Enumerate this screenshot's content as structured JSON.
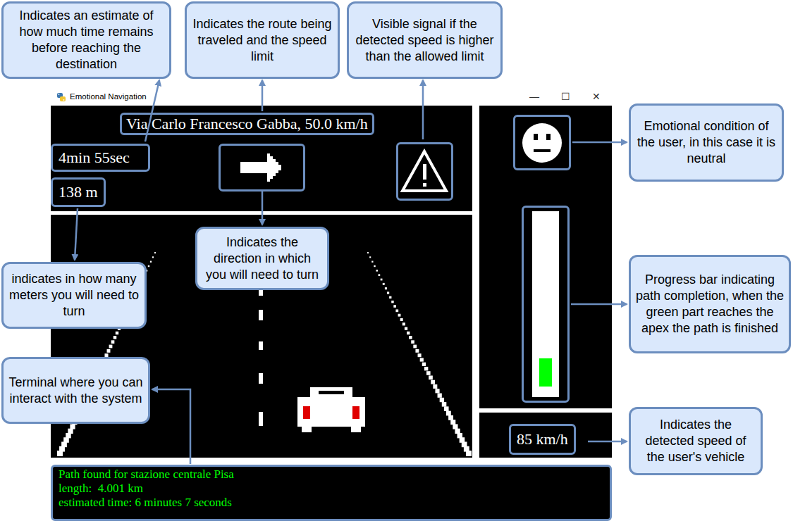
{
  "window": {
    "title": "Emotional Navigation",
    "controls": [
      "—",
      "☐",
      "✕"
    ]
  },
  "hud": {
    "route": "Via Carlo Francesco Gabba, 50.0 km/h",
    "time_remaining": "4min 55sec",
    "distance_to_turn": "138 m",
    "turn": {
      "kind": "right"
    },
    "speed_warning": {
      "on": true
    }
  },
  "emotion": {
    "kind": "neutral"
  },
  "progress": {
    "level": 0.17
  },
  "speed": "85 km/h",
  "terminal": {
    "lines": [
      "Path found for stazione centrale Pisa",
      "length:  4.001 km",
      "estimated time: 6 minutes 7 seconds"
    ]
  },
  "callouts": [
    {
      "text": "Indicates an estimate of how much time remains before reaching the destination"
    },
    {
      "text": "Indicates the route being traveled and the speed limit"
    },
    {
      "text": "Visible signal if the detected speed is higher than the allowed limit"
    },
    {
      "text": "Emotional condition of the user, in this case it is neutral"
    },
    {
      "text": "Progress bar indicating path completion, when the green part reaches the apex the path is finished"
    },
    {
      "text": "Indicates the detected speed of the user's vehicle"
    },
    {
      "text": "Indicates the direction in which you will need to turn"
    },
    {
      "text": "indicates in how many meters you will need to turn"
    },
    {
      "text": "Terminal where you can interact with the system"
    }
  ]
}
